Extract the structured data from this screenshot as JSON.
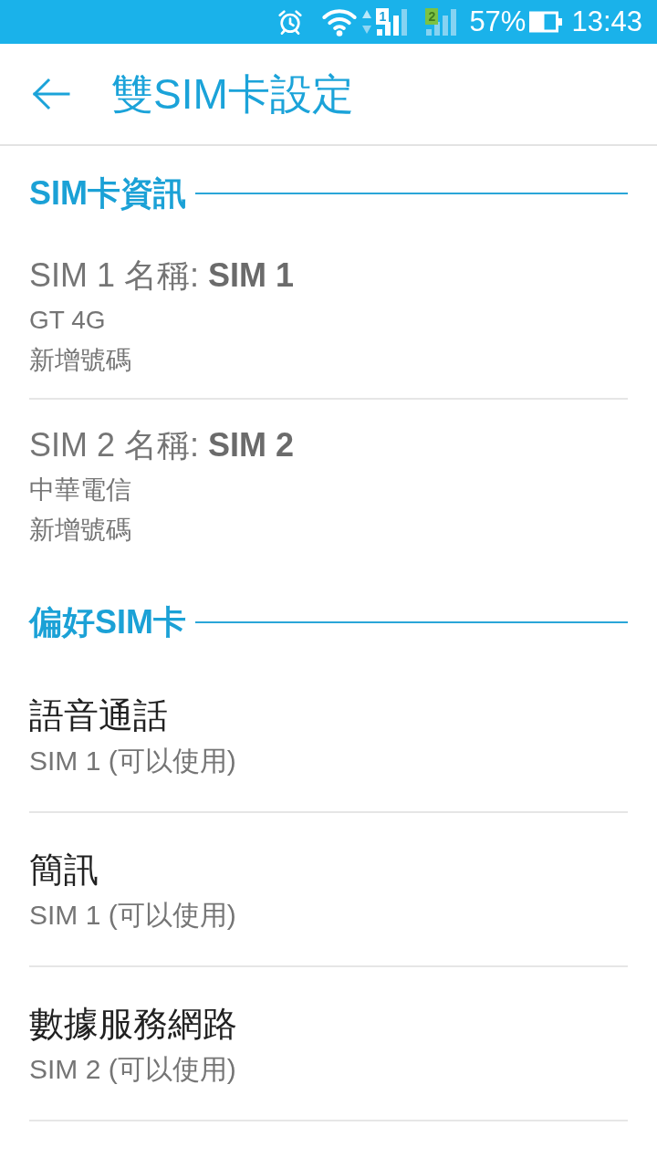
{
  "status_bar": {
    "signals": [
      {
        "badge": "1",
        "color": "#ffffff",
        "active": true
      },
      {
        "badge": "2",
        "color": "#7cc242",
        "active": false
      }
    ],
    "battery": "57%",
    "time": "13:43"
  },
  "app_bar": {
    "title": "雙SIM卡設定"
  },
  "sections": [
    {
      "title": "SIM卡資訊",
      "items": [
        {
          "kind": "sim",
          "title": "SIM 1 名稱: **SIM 1**",
          "lines": [
            "GT 4G",
            "新增號碼"
          ]
        },
        {
          "kind": "sim",
          "title": "SIM 2 名稱: **SIM 2**",
          "lines": [
            "中華電信",
            "新增號碼"
          ]
        }
      ]
    },
    {
      "title": "偏好SIM卡",
      "items": [
        {
          "kind": "preference",
          "title": "語音通話",
          "summary": "SIM 1 (可以使用)"
        },
        {
          "kind": "preference",
          "title": "簡訊",
          "summary": "SIM 1 (可以使用)"
        },
        {
          "kind": "preference",
          "title": "數據服務網路",
          "summary": "SIM 2 (可以使用)"
        }
      ]
    }
  ]
}
